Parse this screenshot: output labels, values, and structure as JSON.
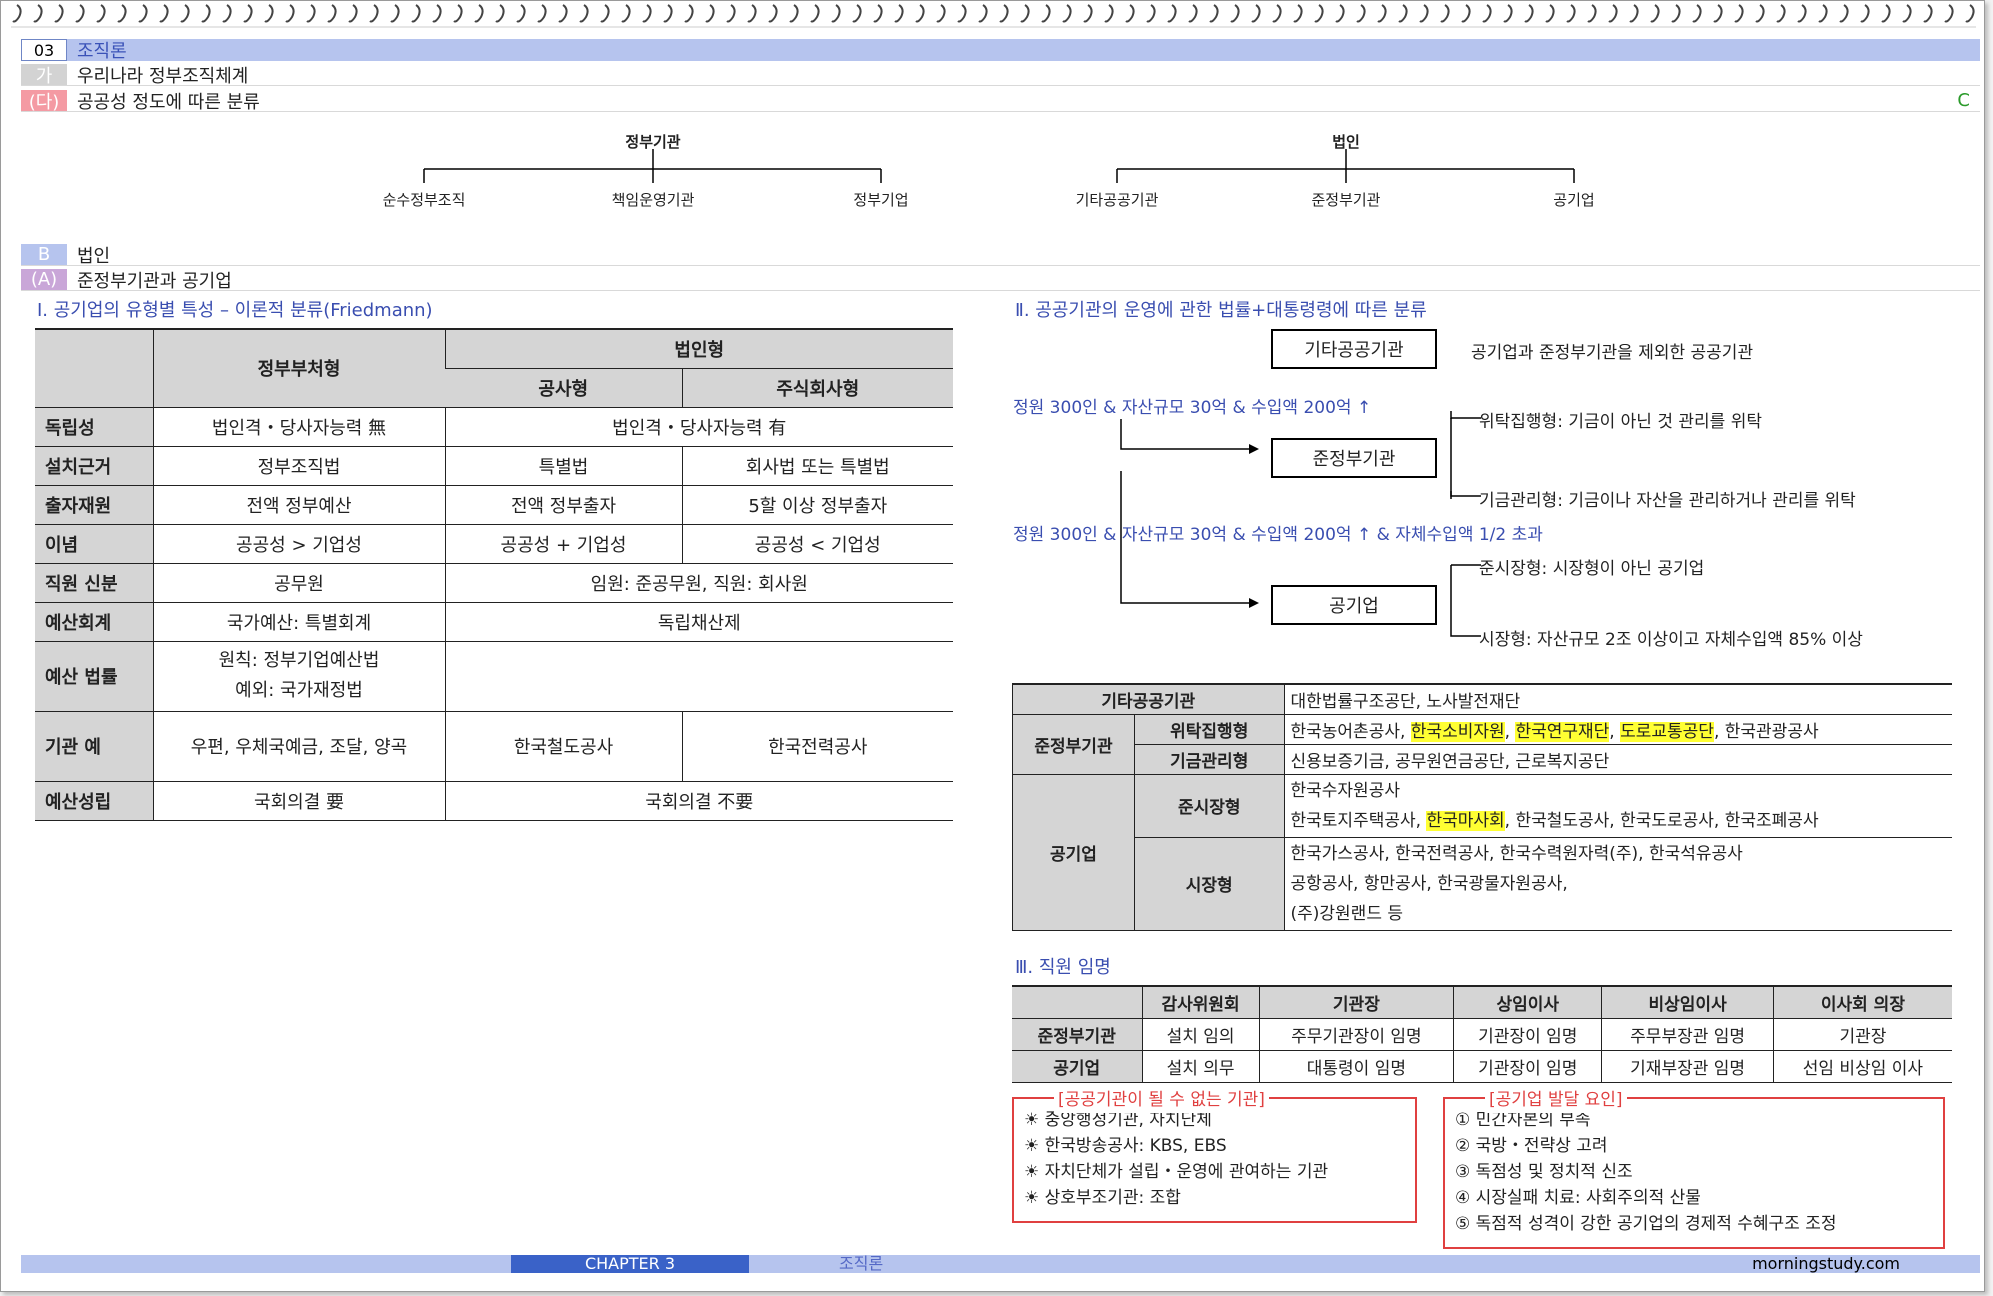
{
  "header": {
    "num": "03",
    "title": "조직론",
    "gaTag": "가",
    "gaTitle": "우리나라 정부조직체계",
    "daTag": "(다)",
    "daTitle": "공공성 정도에 따른 분류",
    "mark": "C",
    "bTag": "B",
    "bTitle": "법인",
    "aTag": "(A)",
    "aTitle": "준정부기관과 공기업"
  },
  "org": {
    "gov": "정부기관",
    "corp": "법인",
    "g1": "순수정부조직",
    "g2": "책임운영기관",
    "g3": "정부기업",
    "c1": "기타공공기관",
    "c2": "준정부기관",
    "c3": "공기업"
  },
  "s1": {
    "title": "Ⅰ. 공기업의 유형별 특성 – 이론적 분류(Friedmann)"
  },
  "t1": {
    "h_gov": "정부부처형",
    "h_corp": "법인형",
    "h_pub": "공사형",
    "h_stock": "주식회사형",
    "rows": [
      {
        "k": "독립성",
        "a": "법인격・당사자능력 無",
        "bc": "법인격・당사자능력 有"
      },
      {
        "k": "설치근거",
        "a": "정부조직법",
        "b": "특별법",
        "c": "회사법 또는 특별법"
      },
      {
        "k": "출자재원",
        "a": "전액 정부예산",
        "b": "전액 정부출자",
        "c": "5할 이상 정부출자"
      },
      {
        "k": "이념",
        "a": "공공성 > 기업성",
        "b": "공공성 + 기업성",
        "c": "공공성 < 기업성"
      },
      {
        "k": "직원 신분",
        "a": "공무원",
        "bc": "임원: 준공무원, 직원: 회사원"
      },
      {
        "k": "예산회계",
        "a": "국가예산: 특별회계",
        "bc": "독립채산제"
      },
      {
        "k": "예산 법률",
        "a1": "원칙: 정부기업예산법",
        "a2": "예외: 국가재정법",
        "bc": ""
      },
      {
        "k": "기관 예",
        "a": "우편, 우체국예금, 조달, 양곡",
        "b": "한국철도공사",
        "c": "한국전력공사"
      },
      {
        "k": "예산성립",
        "a": "국회의결 要",
        "bc": "국회의결 不要"
      }
    ]
  },
  "s2": {
    "title": "Ⅱ. 공공기관의 운영에 관한 법률+대통령령에 따른 분류"
  },
  "flow": {
    "b1": "기타공공기관",
    "b1desc": "공기업과 준정부기관을 제외한 공공기관",
    "cond1": "정원 300인 & 자산규모 30억 & 수입액 200억 ↑",
    "b2": "준정부기관",
    "b2a": "위탁집행형: 기금이 아닌 것 관리를 위탁",
    "b2b": "기금관리형: 기금이나 자산을 관리하거나 관리를 위탁",
    "cond2": "정원 300인 & 자산규모 30억 & 수입액 200억 ↑ & 자체수입액 1/2 초과",
    "b3": "공기업",
    "b3a": "준시장형: 시장형이 아닌 공기업",
    "b3b": "시장형: 자산규모 2조 이상이고 자체수입액 85% 이상"
  },
  "t2": {
    "r1k": "기타공공기관",
    "r1v": "대한법률구조공단, 노사발전재단",
    "jk": "준정부기관",
    "wk": "위탁집행형",
    "w1": "한국농어촌공사, ",
    "w2": "한국소비자원",
    "w3": ", ",
    "w4": "한국연구재단",
    "w5": ", ",
    "w6": "도로교통공단",
    "w7": ", 한국관광공사",
    "gk": "기금관리형",
    "gv": "신용보증기금, 공무원연금공단, 근로복지공단",
    "pk": "공기업",
    "qk": "준시장형",
    "q1": "한국수자원공사",
    "q2a": "한국토지주택공사, ",
    "q2b": "한국마사회",
    "q2c": ", 한국철도공사, 한국도로공사, 한국조폐공사",
    "mk": "시장형",
    "m1": "한국가스공사, 한국전력공사, 한국수력원자력(주), 한국석유공사",
    "m2": "공항공사, 항만공사, 한국광물자원공사,",
    "m3": "(주)강원랜드 등"
  },
  "s3": {
    "title": "Ⅲ. 직원 임명"
  },
  "t3": {
    "h": [
      "감사위원회",
      "기관장",
      "상임이사",
      "비상임이사",
      "이사회 의장"
    ],
    "r1": [
      "준정부기관",
      "설치 임의",
      "주무기관장이 임명",
      "기관장이 임명",
      "주무부장관 임명",
      "기관장"
    ],
    "r2": [
      "공기업",
      "설치 의무",
      "대통령이 임명",
      "기관장이 임명",
      "기재부장관 임명",
      "선임 비상임 이사"
    ]
  },
  "box1": {
    "title": "[공공기관이 될 수 없는 기관]",
    "items": [
      "☀ 중앙행정기관, 자치단체",
      "☀ 한국방송공사: KBS, EBS",
      "☀ 자치단체가 설립・운영에 관여하는 기관",
      "☀ 상호부조기관: 조합"
    ]
  },
  "box2": {
    "title": "[공기업 발달 요인]",
    "items": [
      "① 민간자본의 부족",
      "② 국방・전략상 고려",
      "③ 독점성 및 정치적 신조",
      "④ 시장실패 치료: 사회주의적 산물",
      "⑤ 독점적 성격이 강한 공기업의 경제적 수혜구조 조정"
    ]
  },
  "footer": {
    "chapter": "CHAPTER 3",
    "sub": "조직론",
    "url": "morningstudy.com"
  }
}
